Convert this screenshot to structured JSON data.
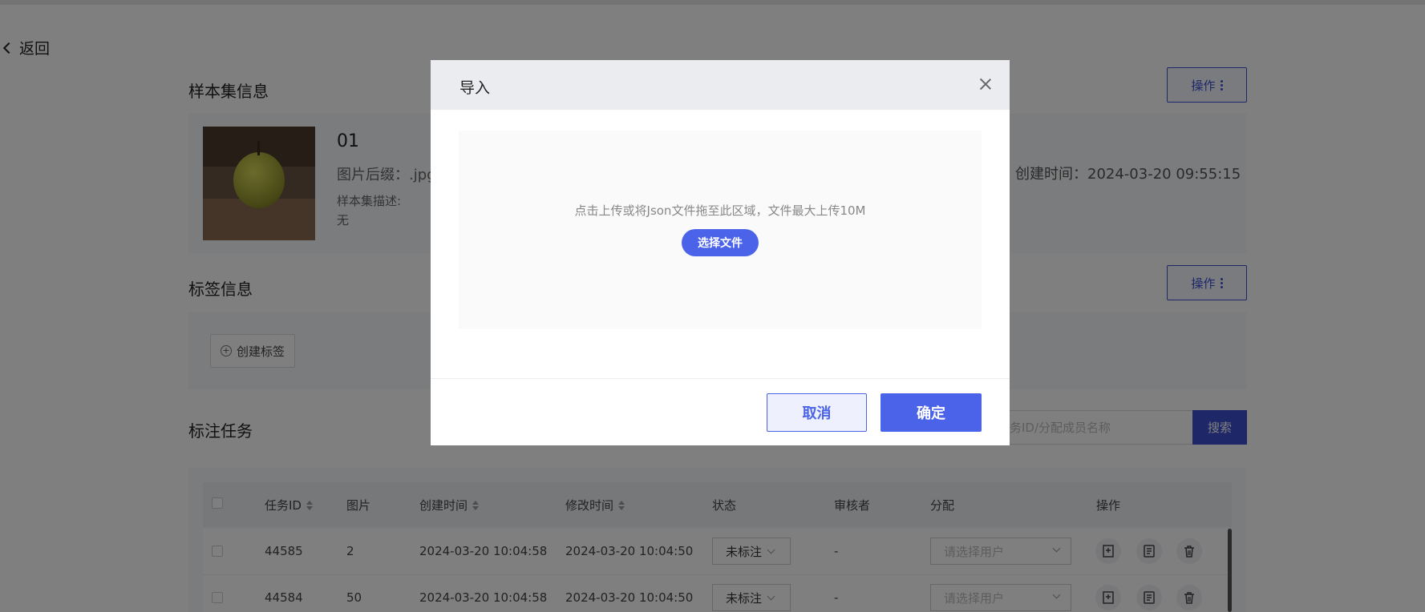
{
  "back_label": "返回",
  "sample_info": {
    "title": "样本集信息",
    "op_label": "操作",
    "name": "01",
    "suffix": "图片后缀：.jpg",
    "desc_label": "样本集描述:",
    "desc_value": "无",
    "created": "创建时间：2024-03-20 09:55:15"
  },
  "tag_info": {
    "title": "标签信息",
    "op_label": "操作",
    "create_tag_label": "创建标签"
  },
  "tasks": {
    "title": "标注任务",
    "search_placeholder": "务ID/分配成员名称",
    "search_label": "搜索",
    "columns": [
      "任务ID",
      "图片",
      "创建时间",
      "修改时间",
      "状态",
      "审核者",
      "分配",
      "操作"
    ],
    "rows": [
      {
        "id": "44585",
        "images": "2",
        "created": "2024-03-20 10:04:58",
        "modified": "2024-03-20 10:04:50",
        "status": "未标注",
        "reviewer": "-",
        "assign": "请选择用户"
      },
      {
        "id": "44584",
        "images": "50",
        "created": "2024-03-20 10:04:58",
        "modified": "2024-03-20 10:04:50",
        "status": "未标注",
        "reviewer": "-",
        "assign": "请选择用户"
      }
    ]
  },
  "modal": {
    "title": "导入",
    "hint": "点击上传或将Json文件拖至此区域，文件最大上传10M",
    "choose_label": "选择文件",
    "cancel_label": "取消",
    "ok_label": "确定"
  },
  "colors": {
    "primary": "#4a63e8",
    "overlay": "rgba(0,0,0,0.5)"
  }
}
